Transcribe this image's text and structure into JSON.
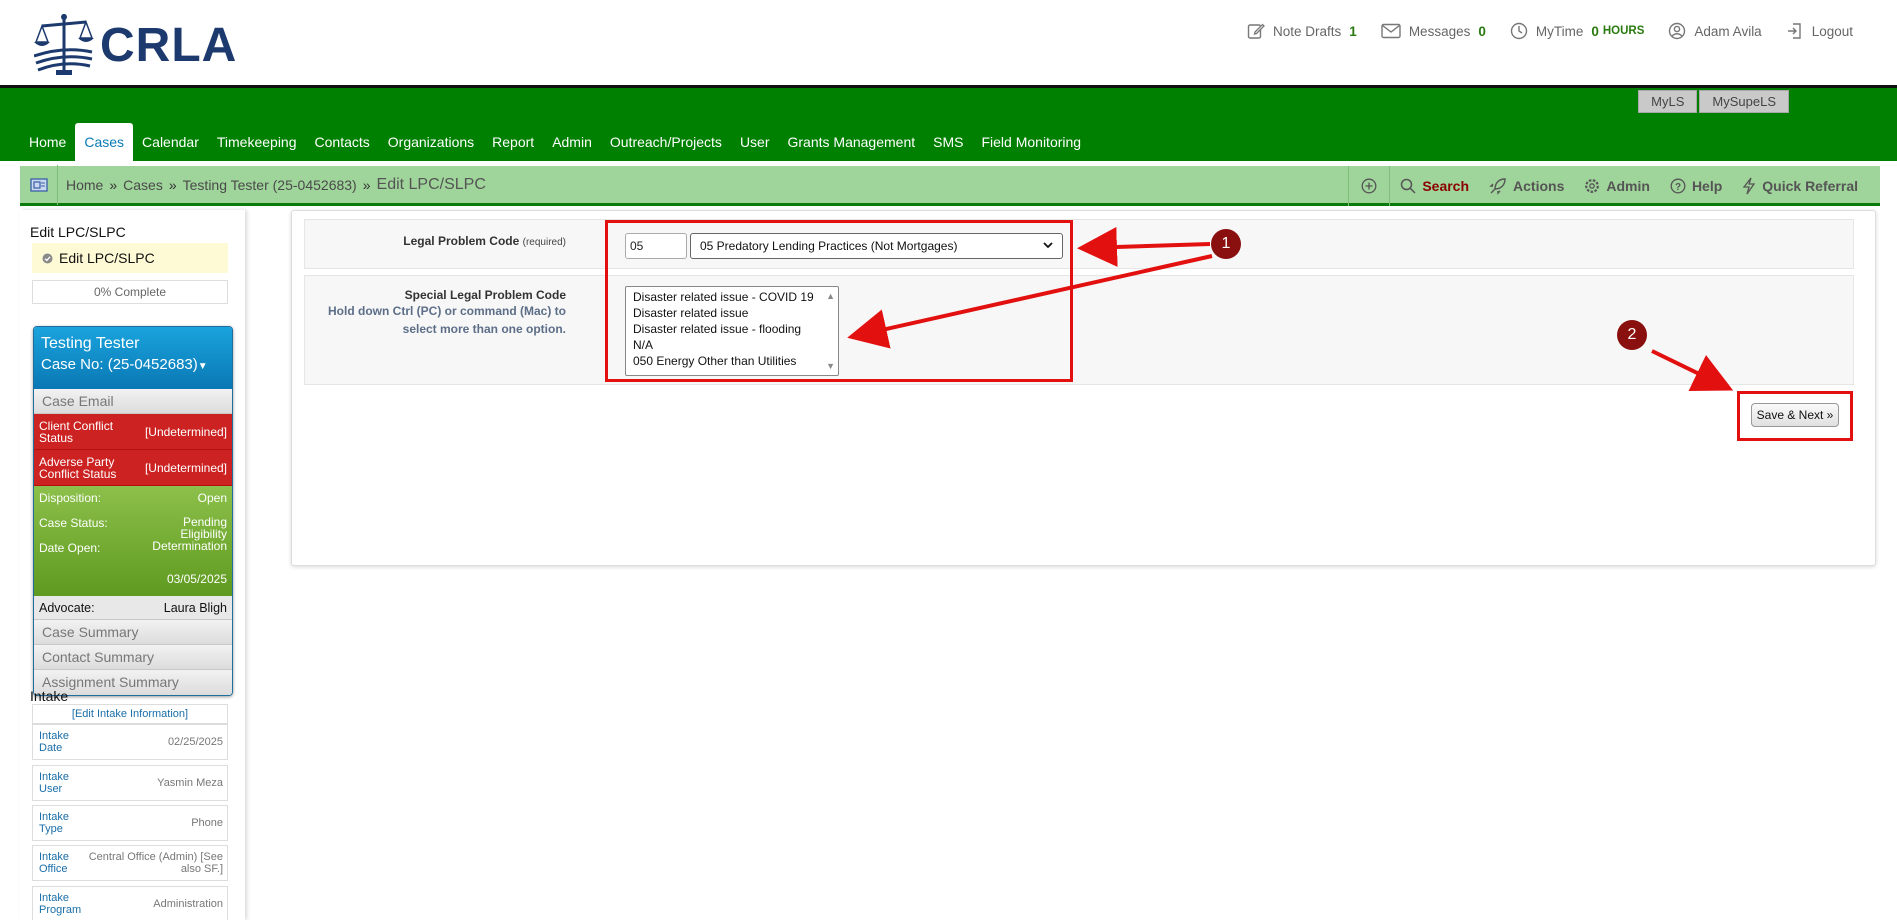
{
  "brand": {
    "name": "CRLA"
  },
  "top_links": {
    "note_drafts": {
      "label": "Note Drafts",
      "count": "1"
    },
    "messages": {
      "label": "Messages",
      "count": "0"
    },
    "mytime": {
      "label": "MyTime",
      "value": "0",
      "unit": "HOURS"
    },
    "user": {
      "label": "Adam Avila"
    },
    "logout": {
      "label": "Logout"
    }
  },
  "myls": {
    "myls": "MyLS",
    "mysupels": "MySupeLS"
  },
  "menu": [
    "Home",
    "Cases",
    "Calendar",
    "Timekeeping",
    "Contacts",
    "Organizations",
    "Report",
    "Admin",
    "Outreach/Projects",
    "User",
    "Grants Management",
    "SMS",
    "Field Monitoring"
  ],
  "breadcrumb": {
    "home": "Home",
    "cases": "Cases",
    "case": "Testing Tester (25-0452683)",
    "current": "Edit LPC/SLPC",
    "sep1": "»",
    "sep2": "»",
    "sep3": "»"
  },
  "tools": {
    "search": "Search",
    "actions": "Actions",
    "admin": "Admin",
    "help": "Help",
    "quick_referral": "Quick Referral"
  },
  "sidebar": {
    "title": "Edit LPC/SLPC",
    "step": "Edit LPC/SLPC",
    "percent": "0% Complete",
    "case": {
      "name": "Testing Tester",
      "number": "Case No: (25-0452683)",
      "email": "Case Email",
      "client_conflict_label": "Client Conflict Status",
      "client_conflict_value": "[Undetermined]",
      "adverse_conflict_label": "Adverse Party Conflict Status",
      "adverse_conflict_value": "[Undetermined]",
      "disposition_label": "Disposition:",
      "disposition_value": "Open",
      "status_label": "Case Status:",
      "status_value": "Pending Eligibility Determination",
      "date_open_label": "Date Open:",
      "date_open_value": "03/05/2025",
      "advocate_label": "Advocate:",
      "advocate_value": "Laura Bligh",
      "links": [
        "Case Summary",
        "Contact Summary",
        "Assignment Summary"
      ]
    },
    "intake": {
      "title": "Intake",
      "edit": "[Edit Intake Information]",
      "rows": [
        {
          "k": "Intake Date",
          "v": "02/25/2025"
        },
        {
          "k": "Intake User",
          "v": "Yasmin Meza"
        },
        {
          "k": "Intake Type",
          "v": "Phone"
        },
        {
          "k": "Intake Office",
          "v": "Central Office (Admin) [See also SF.]"
        },
        {
          "k": "Intake Program",
          "v": "Administration"
        }
      ]
    }
  },
  "form": {
    "lpc_label": "Legal Problem Code",
    "lpc_required": "(required)",
    "lpc_code": "05",
    "lpc_selected": "05 Predatory Lending Practices (Not Mortgages)",
    "slpc_label": "Special Legal Problem Code",
    "slpc_hint": "Hold down Ctrl (PC) or command (Mac) to select more than one option.",
    "slpc_options": [
      "Disaster related issue - COVID 19",
      "Disaster related issue",
      "Disaster related issue - flooding",
      "N/A",
      "050 Energy Other than Utilities"
    ],
    "save_label": "Save & Next »"
  },
  "annotations": {
    "badge1": "1",
    "badge2": "2",
    "arrow_color": "#e31010",
    "badge_color": "#8a0f0f"
  }
}
